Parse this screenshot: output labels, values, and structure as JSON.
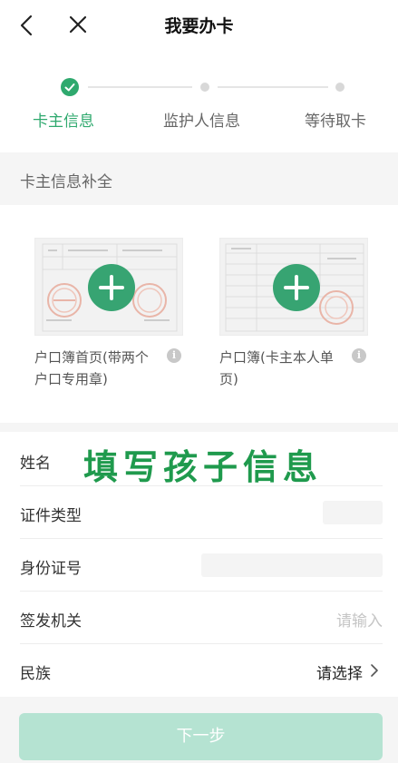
{
  "header": {
    "title": "我要办卡"
  },
  "steps": [
    {
      "label": "卡主信息",
      "state": "done"
    },
    {
      "label": "监护人信息",
      "state": "pending"
    },
    {
      "label": "等待取卡",
      "state": "pending"
    }
  ],
  "section": {
    "title": "卡主信息补全"
  },
  "uploads": [
    {
      "caption": "户口簿首页(带两个户口专用章)"
    },
    {
      "caption": "户口簿(卡主本人单页)"
    }
  ],
  "form": {
    "name_label": "姓名",
    "id_type_label": "证件类型",
    "id_number_label": "身份证号",
    "issuer_label": "签发机关",
    "issuer_placeholder": "请输入",
    "ethnicity_label": "民族",
    "ethnicity_value": "请选择"
  },
  "annotation": {
    "text": "填写孩子信息"
  },
  "footer": {
    "next_label": "下一步"
  },
  "colors": {
    "accent": "#2fa96e",
    "button_disabled": "#b5e3d2"
  }
}
